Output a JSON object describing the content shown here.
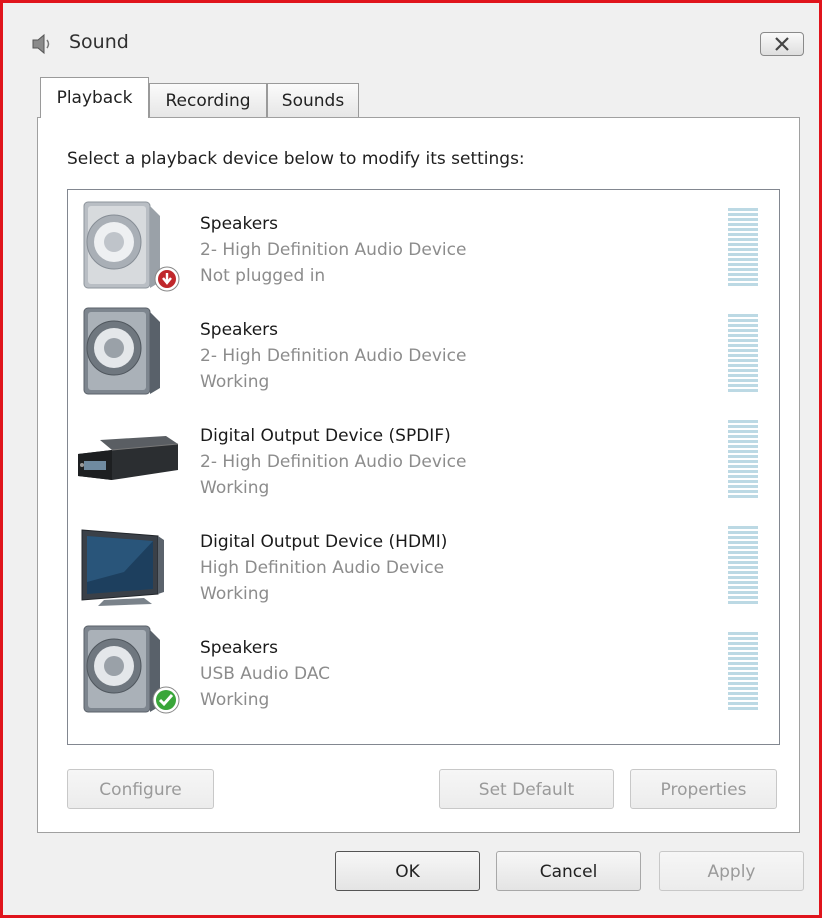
{
  "window": {
    "title": "Sound"
  },
  "tabs": [
    {
      "label": "Playback",
      "active": true
    },
    {
      "label": "Recording",
      "active": false
    },
    {
      "label": "Sounds",
      "active": false
    }
  ],
  "instruction": "Select a playback device below to modify its settings:",
  "devices": [
    {
      "name": "Speakers",
      "description": "2- High Definition Audio Device",
      "status": "Not plugged in",
      "icon": "speaker-icon",
      "badge": "unplugged-badge-icon"
    },
    {
      "name": "Speakers",
      "description": "2- High Definition Audio Device",
      "status": "Working",
      "icon": "speaker-icon",
      "badge": ""
    },
    {
      "name": "Digital Output Device (SPDIF)",
      "description": "2- High Definition Audio Device",
      "status": "Working",
      "icon": "receiver-icon",
      "badge": ""
    },
    {
      "name": "Digital Output Device (HDMI)",
      "description": "High Definition Audio Device",
      "status": "Working",
      "icon": "monitor-icon",
      "badge": ""
    },
    {
      "name": "Speakers",
      "description": "USB Audio DAC",
      "status": "Working",
      "icon": "speaker-icon",
      "badge": "default-check-badge-icon"
    }
  ],
  "buttons": {
    "configure": "Configure",
    "set_default": "Set Default",
    "properties": "Properties",
    "ok": "OK",
    "cancel": "Cancel",
    "apply": "Apply"
  },
  "colors": {
    "window_border": "#e0141c",
    "meter": "#bcd9e4",
    "unplugged_badge": "#c0282c",
    "check_badge": "#3aa63a"
  }
}
